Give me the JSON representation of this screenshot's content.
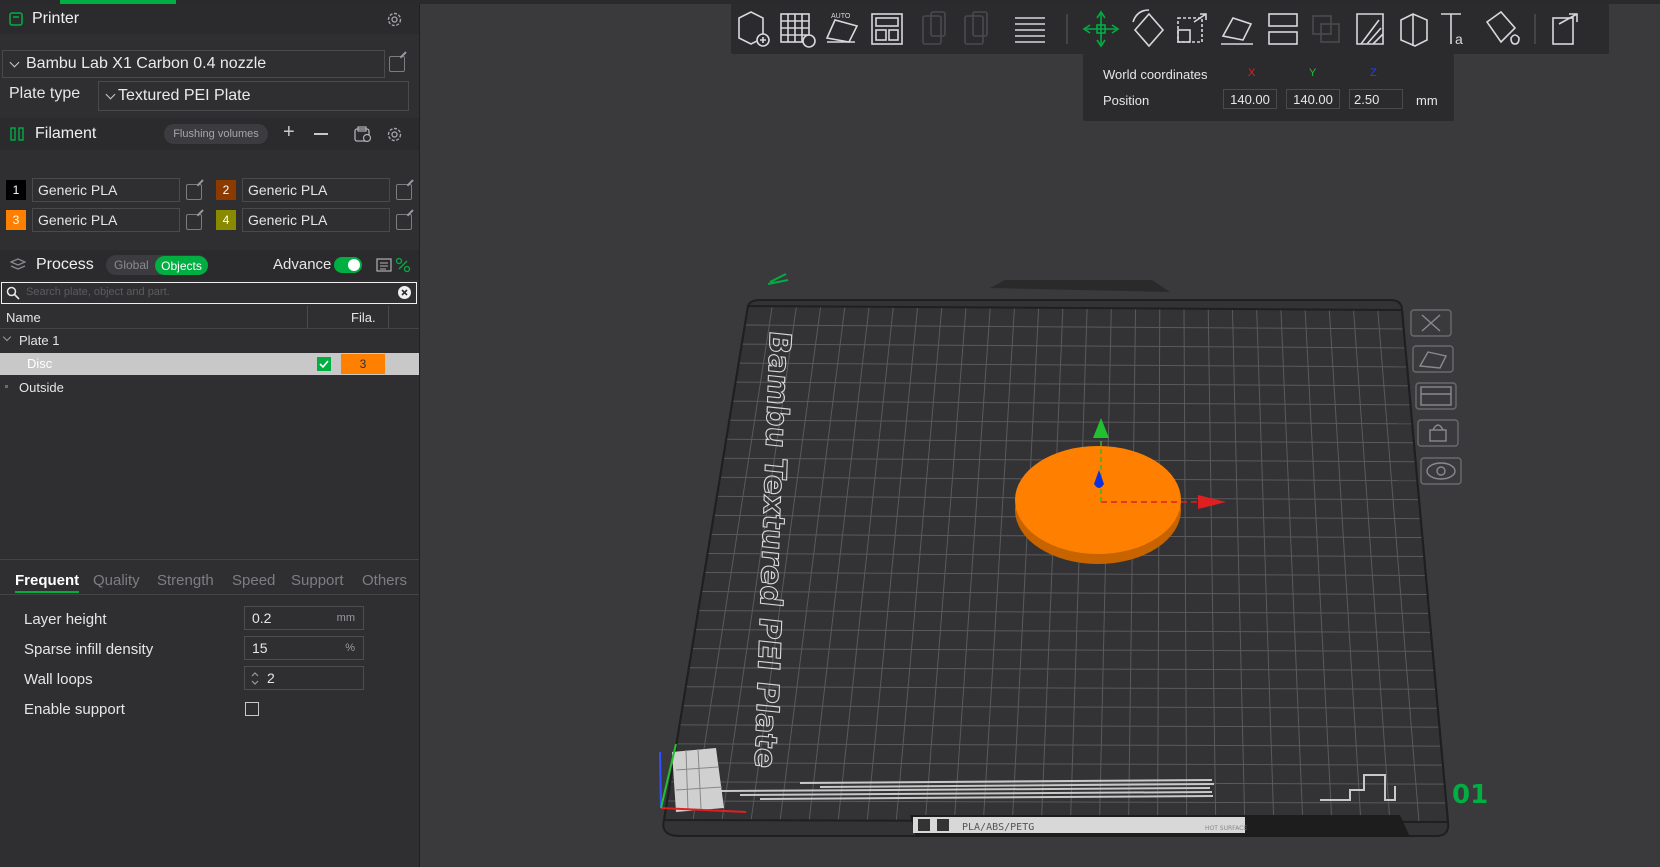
{
  "printer": {
    "title": "Printer",
    "name": "Bambu Lab X1 Carbon 0.4 nozzle",
    "plate_type_label": "Plate type",
    "plate_type_value": "Textured PEI Plate"
  },
  "filament": {
    "title": "Filament",
    "flushing_label": "Flushing volumes",
    "items": [
      {
        "num": "1",
        "name": "Generic PLA",
        "color": "#000000"
      },
      {
        "num": "2",
        "name": "Generic PLA",
        "color": "#8b3a00"
      },
      {
        "num": "3",
        "name": "Generic PLA",
        "color": "#ff7f00"
      },
      {
        "num": "4",
        "name": "Generic PLA",
        "color": "#8a8a00"
      }
    ]
  },
  "process": {
    "title": "Process",
    "global_label": "Global",
    "objects_label": "Objects",
    "advance_label": "Advance",
    "search_placeholder": "Search plate, object and part.",
    "col_name": "Name",
    "col_fila": "Fila.",
    "tree": {
      "plate": "Plate 1",
      "object": "Disc",
      "object_fila": "3",
      "outside": "Outside"
    },
    "tabs": [
      "Frequent",
      "Quality",
      "Strength",
      "Speed",
      "Support",
      "Others"
    ],
    "settings": {
      "layer_height_label": "Layer height",
      "layer_height_value": "0.2",
      "layer_height_unit": "mm",
      "infill_label": "Sparse infill density",
      "infill_value": "15",
      "infill_unit": "%",
      "wall_label": "Wall loops",
      "wall_value": "2",
      "support_label": "Enable support"
    }
  },
  "coords": {
    "title": "World coordinates",
    "x": "X",
    "y": "Y",
    "z": "Z",
    "position_label": "Position",
    "x_val": "140.00",
    "y_val": "140.00",
    "z_val": "2.50",
    "unit": "mm"
  },
  "plate": {
    "side_text": "Bambu Textured PEI Plate",
    "bottom_text": "PLA/ABS/PETG",
    "hot_text": "HOT SURFACE",
    "plate_number": "01"
  },
  "colors": {
    "accent": "#00ae42",
    "object": "#ff8000",
    "panel": "#2f2f32",
    "viewport": "#3a3a3d"
  }
}
